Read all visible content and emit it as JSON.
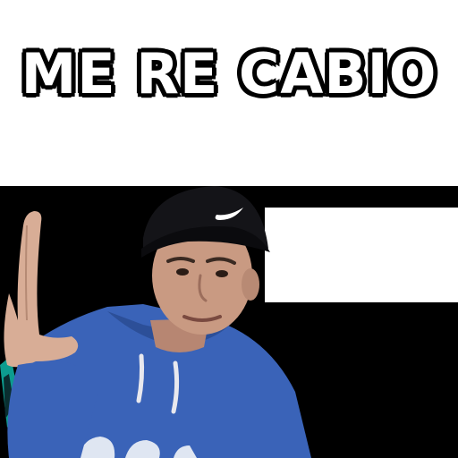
{
  "sticker": {
    "caption": "ME RE CABIO"
  },
  "colors": {
    "background": "#ffffff",
    "caption_fill": "#ffffff",
    "caption_outline": "#000000",
    "photo_background": "#000000",
    "hoodie": "#3a63b8",
    "cap": "#141418",
    "skin": "#c99a82"
  }
}
